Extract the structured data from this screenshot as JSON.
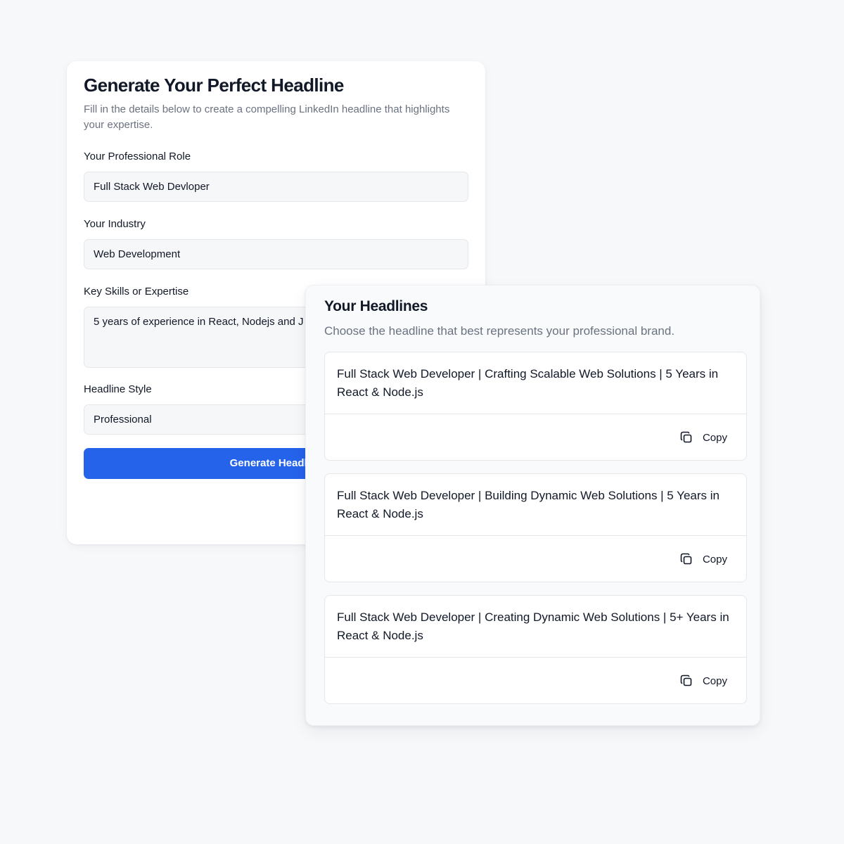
{
  "form": {
    "title": "Generate Your Perfect Headline",
    "subtitle": "Fill in the details below to create a compelling LinkedIn headline that highlights your expertise.",
    "role": {
      "label": "Your Professional Role",
      "value": "Full Stack Web Devloper"
    },
    "industry": {
      "label": "Your Industry",
      "value": "Web Development"
    },
    "skills": {
      "label": "Key Skills or Expertise",
      "value": "5 years of experience in React, Nodejs and J"
    },
    "style": {
      "label": "Headline Style",
      "value": "Professional"
    },
    "generate_label": "Generate Headline"
  },
  "results": {
    "title": "Your Headlines",
    "subtitle": "Choose the headline that best represents your professional brand.",
    "headlines": [
      {
        "text": "Full Stack Web Developer | Crafting Scalable Web Solutions | 5 Years in React & Node.js",
        "copy_label": "Copy"
      },
      {
        "text": "Full Stack Web Developer | Building Dynamic Web Solutions | 5 Years in React & Node.js",
        "copy_label": "Copy"
      },
      {
        "text": "Full Stack Web Developer | Creating Dynamic Web Solutions | 5+ Years in React & Node.js",
        "copy_label": "Copy"
      }
    ]
  },
  "colors": {
    "accent": "#2563eb",
    "page_background": "#f7f8fa",
    "muted_text": "#6b7280",
    "input_background": "#f6f7f9"
  },
  "icons": {
    "copy": "copy-icon"
  }
}
